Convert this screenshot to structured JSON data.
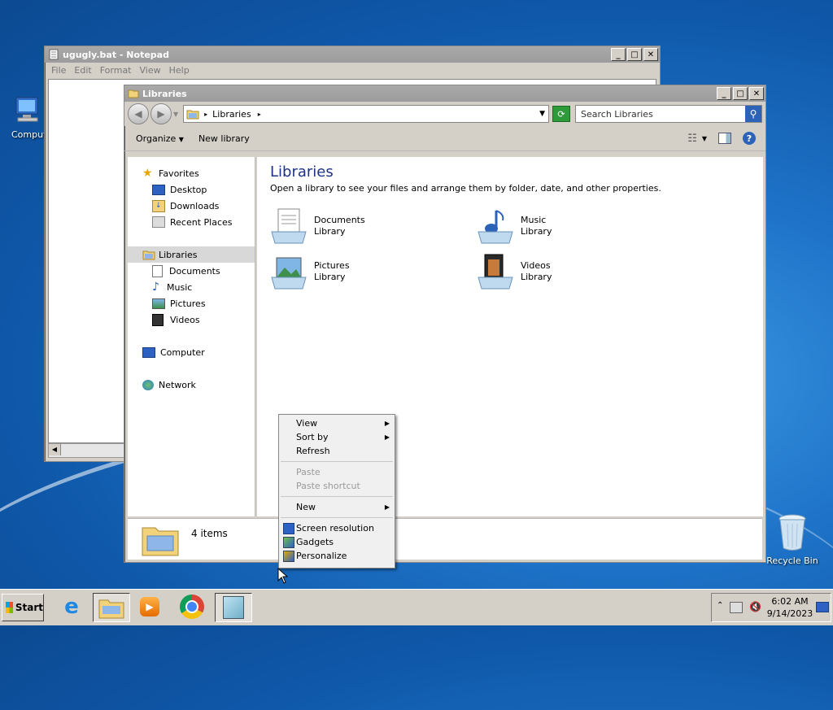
{
  "desktop": {
    "computer_label": "Computer",
    "recycle_label": "Recycle Bin"
  },
  "notepad": {
    "title": "ugugly.bat - Notepad",
    "menu": [
      "File",
      "Edit",
      "Format",
      "View",
      "Help"
    ]
  },
  "explorer": {
    "title": "Libraries",
    "breadcrumb": "Libraries",
    "search_placeholder": "Search Libraries",
    "toolbar": {
      "organize": "Organize",
      "new_library": "New library"
    },
    "nav": {
      "favorites": "Favorites",
      "desktop": "Desktop",
      "downloads": "Downloads",
      "recent": "Recent Places",
      "libraries": "Libraries",
      "documents": "Documents",
      "music": "Music",
      "pictures": "Pictures",
      "videos": "Videos",
      "computer": "Computer",
      "network": "Network"
    },
    "heading": "Libraries",
    "subtitle": "Open a library to see your files and arrange them by folder, date, and other properties.",
    "libs": [
      {
        "name": "Documents",
        "type": "Library"
      },
      {
        "name": "Music",
        "type": "Library"
      },
      {
        "name": "Pictures",
        "type": "Library"
      },
      {
        "name": "Videos",
        "type": "Library"
      }
    ],
    "status": "4 items"
  },
  "context_menu": {
    "view": "View",
    "sort_by": "Sort by",
    "refresh": "Refresh",
    "paste": "Paste",
    "paste_shortcut": "Paste shortcut",
    "new": "New",
    "screen_resolution": "Screen resolution",
    "gadgets": "Gadgets",
    "personalize": "Personalize"
  },
  "taskbar": {
    "start": "Start",
    "time": "6:02 AM",
    "date": "9/14/2023"
  }
}
